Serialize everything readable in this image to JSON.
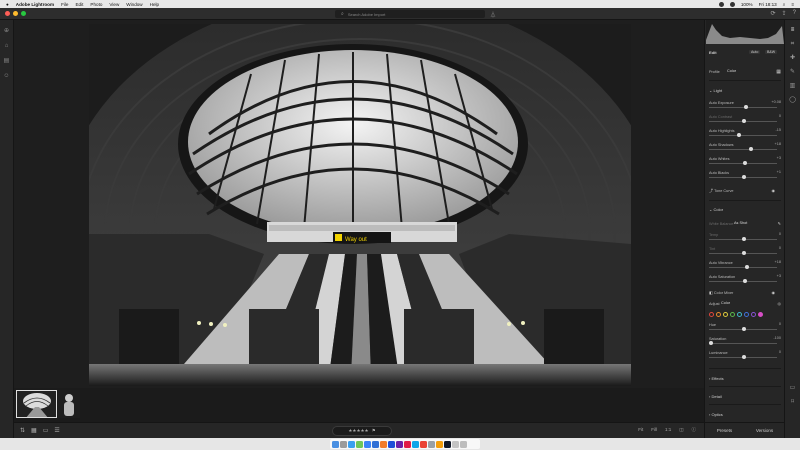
{
  "menubar": {
    "app_name": "Adobe Lightroom",
    "menus": [
      "File",
      "Edit",
      "Photo",
      "View",
      "Window",
      "Help"
    ],
    "battery": "100%",
    "clock": "Fri 18:13"
  },
  "search": {
    "placeholder": "Search Adobe Import"
  },
  "panel": {
    "title": "Edit",
    "mode_auto": "Auto",
    "mode_bw": "B&W",
    "profile_label": "Profile",
    "profile_value": "Color",
    "light": {
      "title": "Light",
      "sliders": [
        {
          "label": "Auto Exposure",
          "value": "+0.08",
          "pos": 0.53
        },
        {
          "label": "Auto Contrast",
          "value": "0",
          "pos": 0.5,
          "dim": true
        },
        {
          "label": "Auto Highlights",
          "value": "-15",
          "pos": 0.42
        },
        {
          "label": "Auto Shadows",
          "value": "+18",
          "pos": 0.6
        },
        {
          "label": "Auto Whites",
          "value": "+3",
          "pos": 0.51
        },
        {
          "label": "Auto Blacks",
          "value": "+1",
          "pos": 0.5
        }
      ],
      "tone_curve": "Tone Curve"
    },
    "color": {
      "title": "Color",
      "white_balance_label": "White Balance",
      "white_balance_value": "As Shot",
      "sliders": [
        {
          "label": "Temp",
          "value": "0",
          "pos": 0.5,
          "dim": true
        },
        {
          "label": "Tint",
          "value": "0",
          "pos": 0.5,
          "dim": true
        },
        {
          "label": "Auto Vibrance",
          "value": "+18",
          "pos": 0.55
        },
        {
          "label": "Auto Saturation",
          "value": "+3",
          "pos": 0.51
        }
      ],
      "mixer_title": "Color Mixer",
      "adjust_label": "Adjust",
      "adjust_value": "Color",
      "swatches": [
        "#e0453b",
        "#e58a2c",
        "#dcc93b",
        "#5ab64a",
        "#3fb6c8",
        "#3f6fd8",
        "#8752d3",
        "#d64ec6"
      ],
      "mixer_sliders": [
        {
          "label": "Hue",
          "value": "0",
          "pos": 0.5
        },
        {
          "label": "Saturation",
          "value": "-100",
          "pos": 0.0
        },
        {
          "label": "Luminance",
          "value": "0",
          "pos": 0.5
        }
      ]
    },
    "sections": [
      "Effects",
      "Detail",
      "Optics"
    ],
    "footer": {
      "presets": "Presets",
      "versions": "Versions"
    }
  },
  "bottombar": {
    "sort_icons": [
      "sort-icon",
      "grid-icon",
      "single-icon"
    ],
    "rating": "★★★★★",
    "zoom_fit": "Fit",
    "zoom_fill": "Fill",
    "zoom_1to1": "1:1"
  },
  "photo": {
    "sign_text": "Way out"
  }
}
